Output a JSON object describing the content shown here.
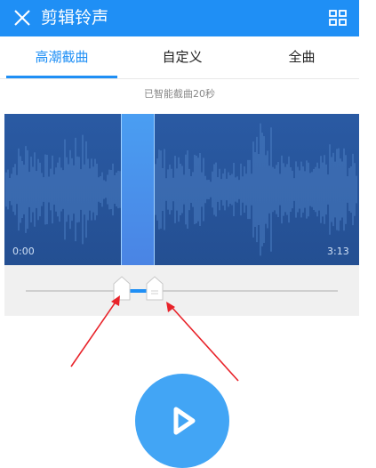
{
  "header": {
    "title": "剪辑铃声",
    "close_icon": "close-icon",
    "grid_icon": "grid-icon",
    "background": "#1f8ff5"
  },
  "tabs": [
    {
      "label": "高潮截曲",
      "active": true
    },
    {
      "label": "自定义",
      "active": false
    },
    {
      "label": "全曲",
      "active": false
    }
  ],
  "status_text": "已智能截曲20秒",
  "waveform": {
    "start_time": "0:00",
    "end_time": "3:13",
    "selection_color": "#4a9ef2"
  },
  "play_icon": "play-icon",
  "accent": "#1f8ff5"
}
